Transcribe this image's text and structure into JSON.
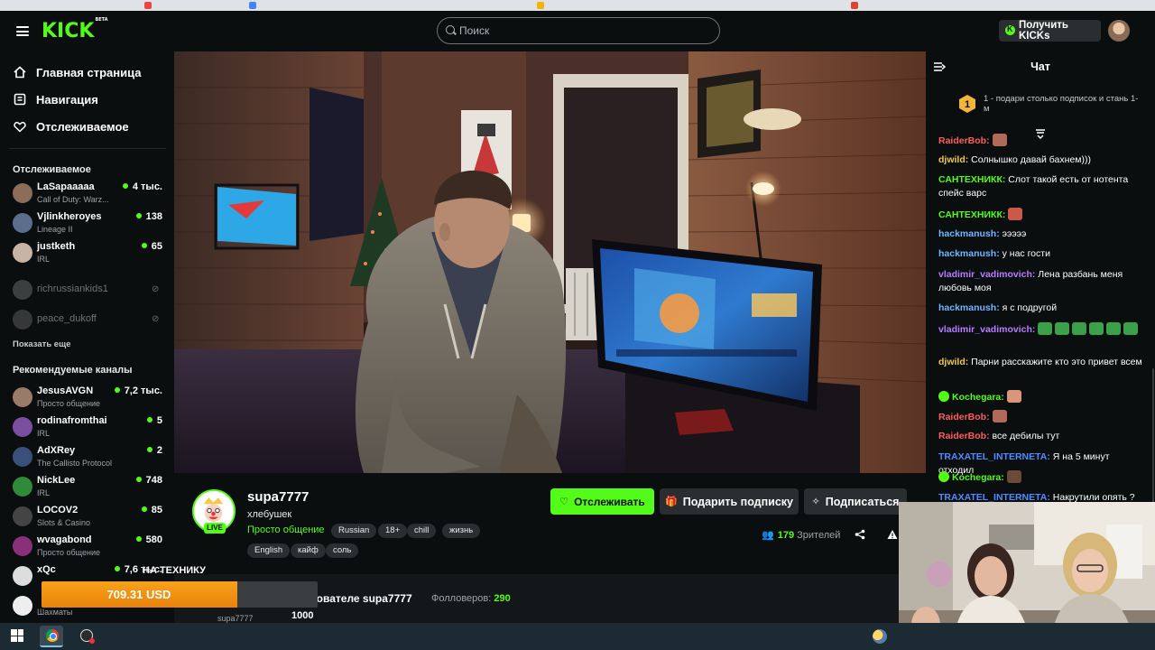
{
  "topbar": {
    "logo": "KICK",
    "logo_tag": "BETA",
    "search_placeholder": "Поиск",
    "kicks_button": "Получить KICKs"
  },
  "nav": [
    {
      "label": "Главная страница",
      "icon": "home-icon"
    },
    {
      "label": "Навигация",
      "icon": "compass-icon"
    },
    {
      "label": "Отслеживаемое",
      "icon": "heart-icon"
    }
  ],
  "followed": {
    "heading": "Отслеживаемое",
    "channels": [
      {
        "name": "LaSapaaaaa",
        "category": "Call of Duty: Warz...",
        "viewers": "4 тыс.",
        "avatar_color": "#8a6e5a"
      },
      {
        "name": "Vjlinkheroyes",
        "category": "Lineage II",
        "viewers": "138",
        "avatar_color": "#5b6e8c"
      },
      {
        "name": "justketh",
        "category": "IRL",
        "viewers": "65",
        "avatar_color": "#c9b3a4"
      }
    ],
    "offline": [
      {
        "name": "richrussiankids1",
        "avatar_color": "#7a7a7a"
      },
      {
        "name": "peace_dukoff",
        "avatar_color": "#6a6a6a"
      }
    ],
    "show_more": "Показать еще"
  },
  "recommended": {
    "heading": "Рекомендуемые каналы",
    "channels": [
      {
        "name": "JesusAVGN",
        "category": "Просто общение",
        "viewers": "7,2 тыс.",
        "avatar_color": "#9a7a68"
      },
      {
        "name": "rodinafromthai",
        "category": "IRL",
        "viewers": "5",
        "avatar_color": "#7b4fa0"
      },
      {
        "name": "AdXRey",
        "category": "The Callisto Protocol",
        "viewers": "2",
        "avatar_color": "#3a4f7a"
      },
      {
        "name": "NickLee",
        "category": "IRL",
        "viewers": "748",
        "avatar_color": "#2f8a3a"
      },
      {
        "name": "LOCOV2",
        "category": "Slots & Casino",
        "viewers": "85",
        "avatar_color": "#444"
      },
      {
        "name": "wvagabond",
        "category": "Просто общение",
        "viewers": "580",
        "avatar_color": "#8a2f7a"
      },
      {
        "name": "xQc",
        "category": "",
        "viewers": "7,6 тыс.",
        "avatar_color": "#ddd"
      },
      {
        "name": "",
        "category": "Шахматы",
        "viewers": "",
        "avatar_color": "#eee"
      }
    ]
  },
  "stream": {
    "streamer": "supa7777",
    "title": "хлебушек",
    "category": "Просто общение",
    "live_label": "LIVE",
    "tags_row1": [
      "Russian",
      "18+",
      "chill",
      "жизнь"
    ],
    "tags_row2": [
      "English",
      "кайф",
      "соль"
    ],
    "follow_label": "Отслеживать",
    "gift_label": "Подарить подписку",
    "subscribe_label": "Подписаться",
    "viewers_count": "179",
    "viewers_label": "Зрителей"
  },
  "about": {
    "title": "зователе supa7777",
    "followers_label": "Фолловеров:",
    "followers_count": "290",
    "sub_name": "supa7777",
    "sub_value": "1000"
  },
  "goal": {
    "label": "НА ТЕХНИКУ",
    "value": "709.31 USD",
    "fraction": 0.709
  },
  "chat": {
    "title": "Чат",
    "gift_rank": "1",
    "gift_text": "1 - подари столько подписок и стань 1-м",
    "messages": [
      {
        "user": "RaiderBob:",
        "text": "",
        "color": "#ff5c5c",
        "emote": "#b06a5a"
      },
      {
        "user": "djwild:",
        "text": "Солнышко давай бахнем)))",
        "color": "#f2c94c"
      },
      {
        "user": "САНТЕХНИКК:",
        "text": "Слот такой есть от нотента спейс варс",
        "color": "#53fc18"
      },
      {
        "user": "САНТЕХНИКК:",
        "text": "",
        "color": "#53fc18",
        "emote": "#c95a4a"
      },
      {
        "user": "hackmanush:",
        "text": "эээээ",
        "color": "#6fb7ff"
      },
      {
        "user": "hackmanush:",
        "text": "у нас гости",
        "color": "#6fb7ff"
      },
      {
        "user": "vladimir_vadimovich:",
        "text": "Лена разбань меня любовь моя",
        "color": "#b77cff"
      },
      {
        "user": "hackmanush:",
        "text": "я с подругой",
        "color": "#6fb7ff"
      },
      {
        "user": "vladimir_vadimovich:",
        "text": "",
        "color": "#b77cff",
        "emote": "#3aa04a"
      },
      {
        "user": "djwild:",
        "text": "Парни расскажите кто это привет всем",
        "color": "#f2c94c"
      },
      {
        "user": "Kochegara:",
        "text": "",
        "color": "#53fc18",
        "emote": "#d9967a"
      },
      {
        "user": "RaiderBob:",
        "text": "",
        "color": "#ff5c5c",
        "emote": "#b06a5a"
      },
      {
        "user": "RaiderBob:",
        "text": "все дебилы тут",
        "color": "#ff5c5c"
      },
      {
        "user": "TRAXATEL_INTERNETA:",
        "text": "Я на 5 минут отходил",
        "color": "#4f8cff"
      },
      {
        "user": "Kochegara:",
        "text": "",
        "color": "#53fc18",
        "emote": "#6a4a3a"
      },
      {
        "user": "TRAXATEL_INTERNETA:",
        "text": "Накрутили опять ?",
        "color": "#4f8cff"
      }
    ]
  }
}
